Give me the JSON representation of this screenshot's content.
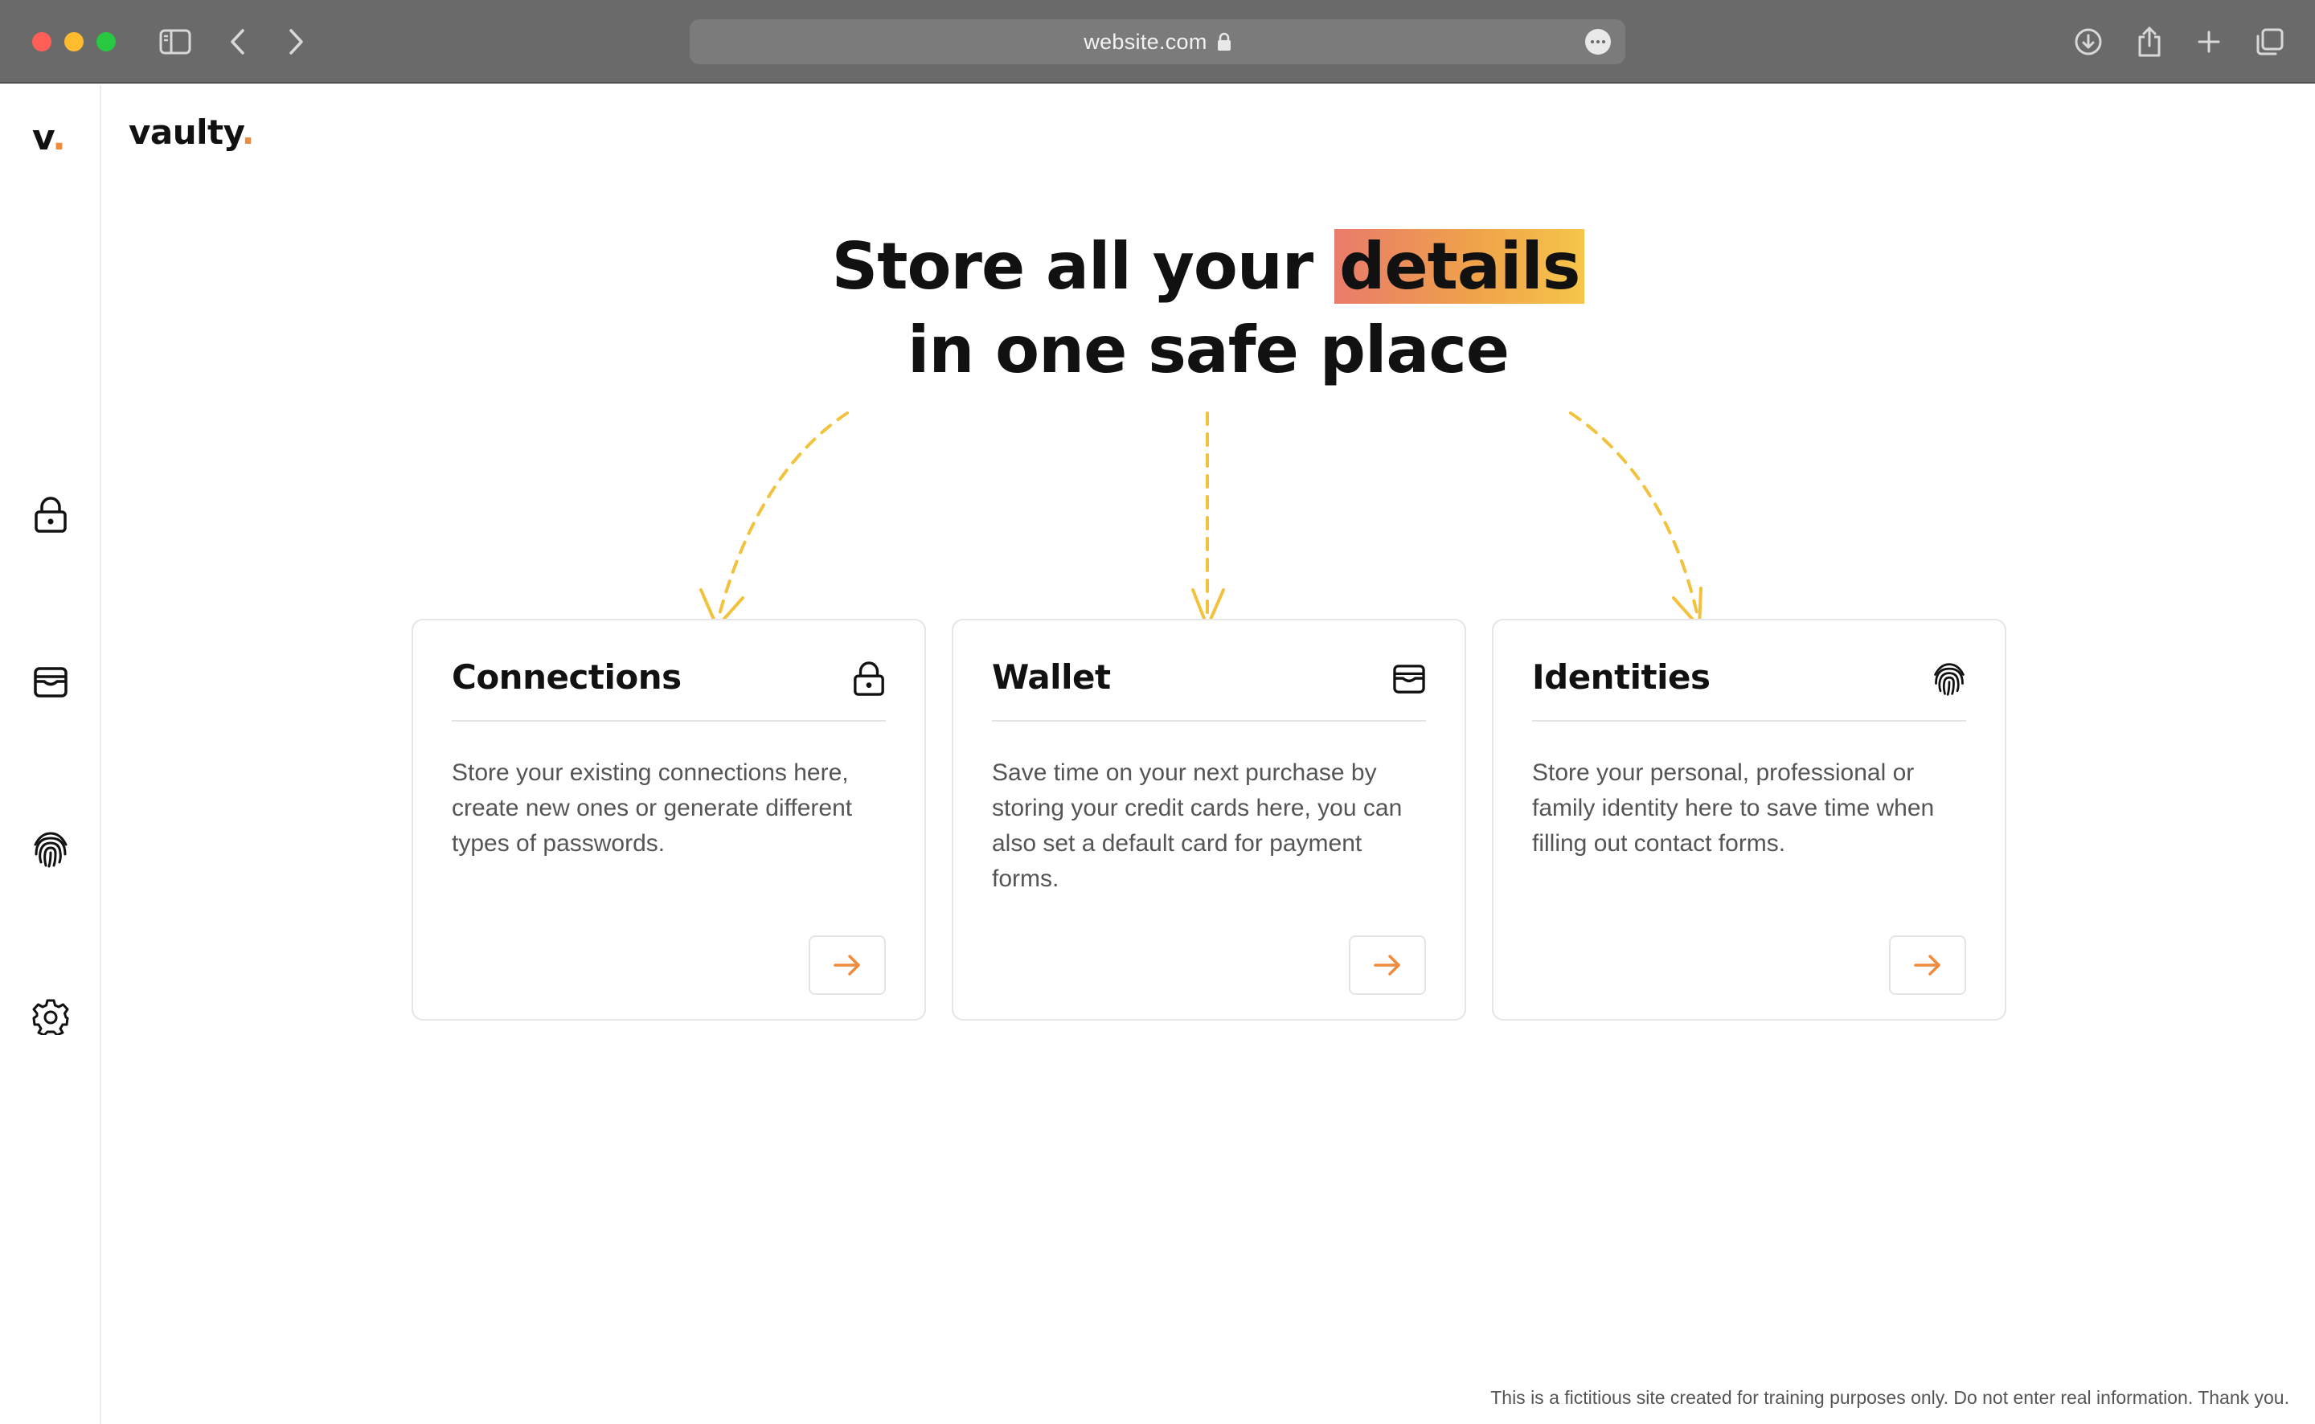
{
  "browser": {
    "url": "website.com",
    "icons": [
      "sidebar-toggle-icon",
      "back-icon",
      "forward-icon",
      "lock-icon",
      "more-icon",
      "download-icon",
      "share-icon",
      "new-tab-icon",
      "tabs-overview-icon"
    ]
  },
  "sidebar": {
    "logo_letter": "v",
    "logo_dot": ".",
    "items": [
      {
        "name": "connections",
        "icon": "lock-icon"
      },
      {
        "name": "wallet",
        "icon": "wallet-icon"
      },
      {
        "name": "identities",
        "icon": "fingerprint-icon"
      },
      {
        "name": "settings",
        "icon": "gear-icon"
      }
    ]
  },
  "brand": {
    "name": "vaulty",
    "dot": "."
  },
  "hero": {
    "line1_prefix": "Store all your ",
    "highlight": "details",
    "line2": "in one safe place"
  },
  "cards": [
    {
      "title": "Connections",
      "icon": "lock-icon",
      "description": "Store your existing connections here, create new ones or generate different types of passwords."
    },
    {
      "title": "Wallet",
      "icon": "wallet-icon",
      "description": "Save time on your next purchase by storing your credit cards here, you can also set a default card for payment forms."
    },
    {
      "title": "Identities",
      "icon": "fingerprint-icon",
      "description": "Store your personal, professional or family identity here to save time when filling out contact forms."
    }
  ],
  "footer": {
    "note": "This is a fictitious site created for training purposes only. Do not enter real information. Thank you."
  },
  "colors": {
    "accent": "#f08a3c",
    "highlight_start": "#e97b6c",
    "highlight_end": "#f6c64a",
    "arrow": "#f2c23c"
  }
}
